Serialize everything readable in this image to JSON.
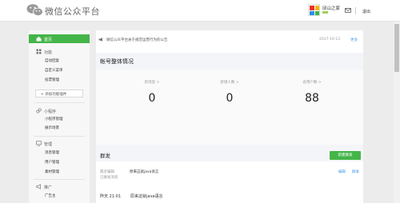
{
  "header": {
    "title": "微信公众平台",
    "account_name": "邱山之家",
    "logout_label": "退出"
  },
  "sidebar": {
    "home_label": "首页",
    "groups": [
      {
        "label": "功能",
        "items": [
          "自动回复",
          "自定义菜单",
          "投票管理"
        ]
      },
      {
        "label": "小程序",
        "items": [
          "小程序管理",
          "展示场景"
        ]
      },
      {
        "label": "管理",
        "items": [
          "消息管理",
          "用户管理",
          "素材管理"
        ]
      },
      {
        "label": "推广",
        "items": [
          "广告主"
        ]
      }
    ],
    "add_plugin_label": "添加功能插件"
  },
  "notice": {
    "text": "微信公众平台关于规范运营行为的公告",
    "date": "2017-10-13",
    "more_label": "更多"
  },
  "account_overview": {
    "title": "帐号整体情况",
    "stats": [
      {
        "label": "新消息",
        "value": "0"
      },
      {
        "label": "新增人数",
        "value": "0"
      },
      {
        "label": "总用户数",
        "value": "88"
      }
    ]
  },
  "broadcast": {
    "title": "群发",
    "new_button_label": "新建群发",
    "draft_label": "最近编辑",
    "draft_title": "原来这就java语言",
    "edit_label": "编辑",
    "send_label": "群发",
    "sent_label": "已群发消息",
    "sent_time": "昨天 21:01",
    "sent_title": "原来这就java语言"
  },
  "colors": {
    "brand_green": "#44b549",
    "link_blue": "#459ae9"
  }
}
